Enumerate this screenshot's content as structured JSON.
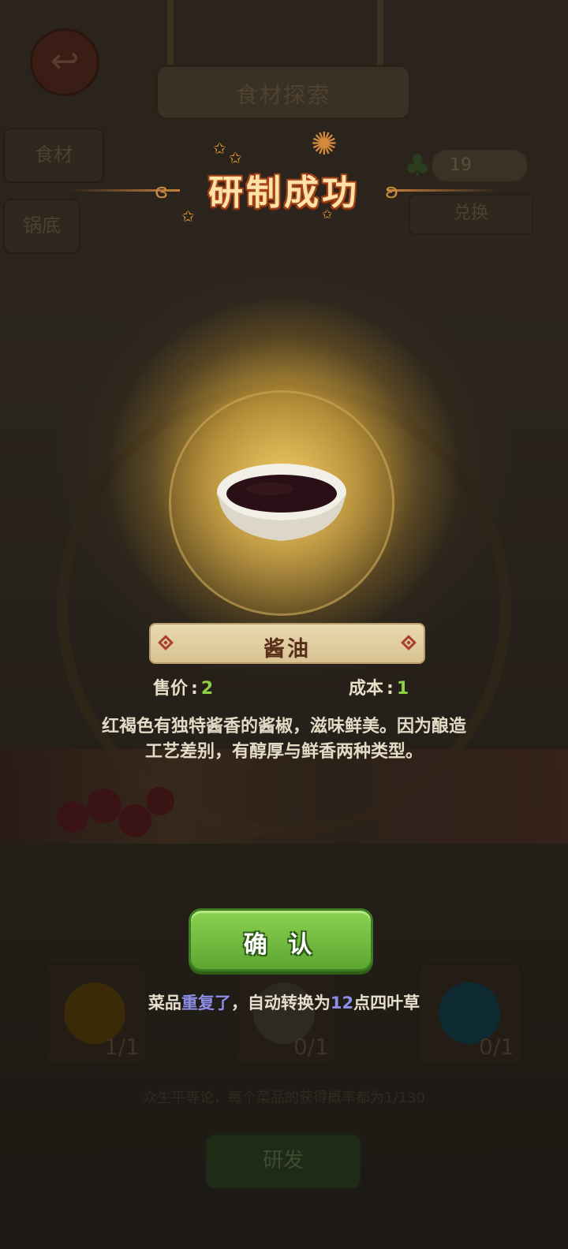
{
  "background": {
    "sign_title": "食材探索",
    "tabs": [
      "食材",
      "锅底"
    ],
    "clover_count": "19",
    "exchange_label": "兑换",
    "cards": [
      {
        "count": "1/1",
        "color": "#3a2a08"
      },
      {
        "count": "0/1",
        "color": "#2e2a22"
      },
      {
        "count": "0/1",
        "color": "#0e2a33"
      }
    ],
    "rule_text": "众生平等论，每个菜品的获得概率都为1/130",
    "develop_label": "研发"
  },
  "popup": {
    "title": "研制成功",
    "item_icon": "soy-sauce-bowl-icon",
    "item_name": "酱油",
    "price_label": "售价",
    "price_value": "2",
    "cost_label": "成本",
    "cost_value": "1",
    "description_line1": "红褐色有独特酱香的酱椒，滋味鲜美。因为酿造",
    "description_line2": "工艺差别，有醇厚与鲜香两种类型。",
    "confirm_label": "确 认",
    "notice": {
      "prefix": "菜品",
      "highlight1": "重复了",
      "middle": "，自动转换为",
      "highlight2": "12",
      "suffix": "点四叶草"
    }
  },
  "colors": {
    "accent_green": "#6bb83a",
    "highlight_purple": "#8c8ee8",
    "number_green": "#8fd044",
    "title_orange": "#9c3d17"
  }
}
